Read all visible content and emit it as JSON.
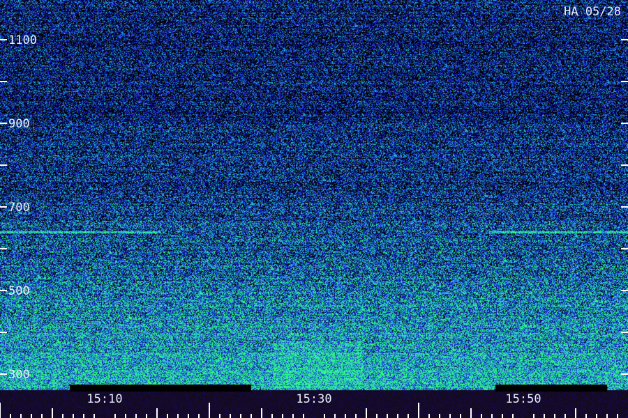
{
  "chart_data": {
    "type": "heatmap",
    "title": "HA 05/28",
    "y_ticks": [
      300,
      500,
      700,
      900,
      1100
    ],
    "y_minor_ticks": [
      400,
      600,
      800,
      1000
    ],
    "ylim": [
      280,
      1150
    ],
    "x_ticks": [
      "15:10",
      "15:30",
      "15:50"
    ],
    "x_tick_minutes": [
      10,
      30,
      50
    ],
    "xlim_minutes": [
      0,
      59.5
    ],
    "colormap": [
      "#000000",
      "#1a1acc",
      "#1f6fe0",
      "#2ac8d8",
      "#33ff7a"
    ],
    "intensity_profile": "higher at low frequencies (300–650) and fading toward 1100; narrow bright line near 640 at start and end of interval"
  }
}
